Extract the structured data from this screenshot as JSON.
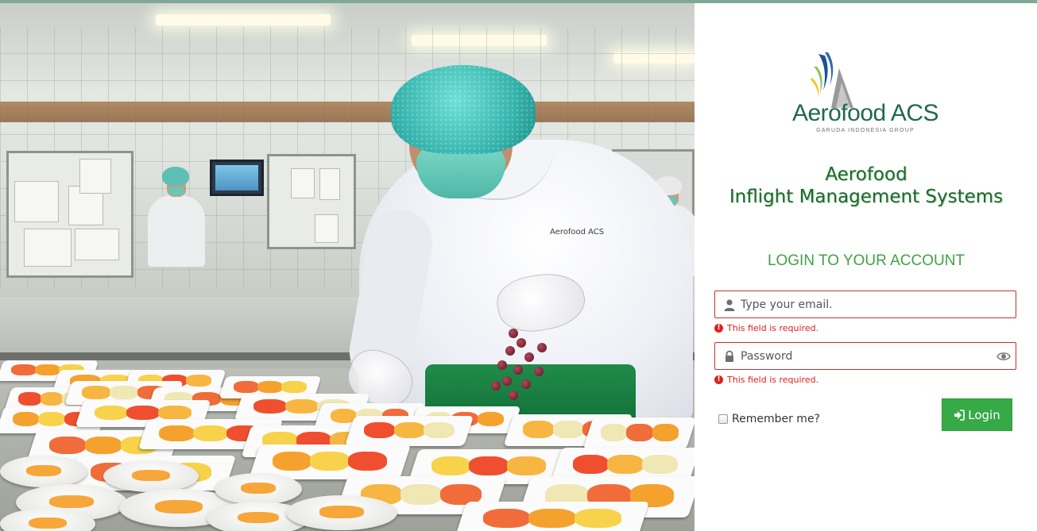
{
  "brand": {
    "name": "Aerofood ACS",
    "group": "GARUDA INDONESIA GROUP",
    "chef_patch": "Aerofood ACS"
  },
  "app": {
    "title_line1": "Aerofood",
    "title_line2": "Inflight Management Systems"
  },
  "login": {
    "heading": "LOGIN TO YOUR ACCOUNT",
    "email_placeholder": "Type your email.",
    "email_value": "",
    "email_error": "This field is required.",
    "password_placeholder": "Password",
    "password_value": "",
    "password_error": "This field is required.",
    "remember_label": "Remember me?",
    "remember_checked": false,
    "button_label": "Login"
  },
  "icons": {
    "email": "user-icon",
    "password": "lock-icon",
    "toggle": "eye-icon",
    "error": "exclamation-circle-icon",
    "button": "sign-in-icon"
  },
  "colors": {
    "brand_green": "#1f6a4a",
    "heading_green": "#43a047",
    "button_green": "#35aa47",
    "error_red": "#e0201b",
    "field_border_error": "#c9302c"
  }
}
